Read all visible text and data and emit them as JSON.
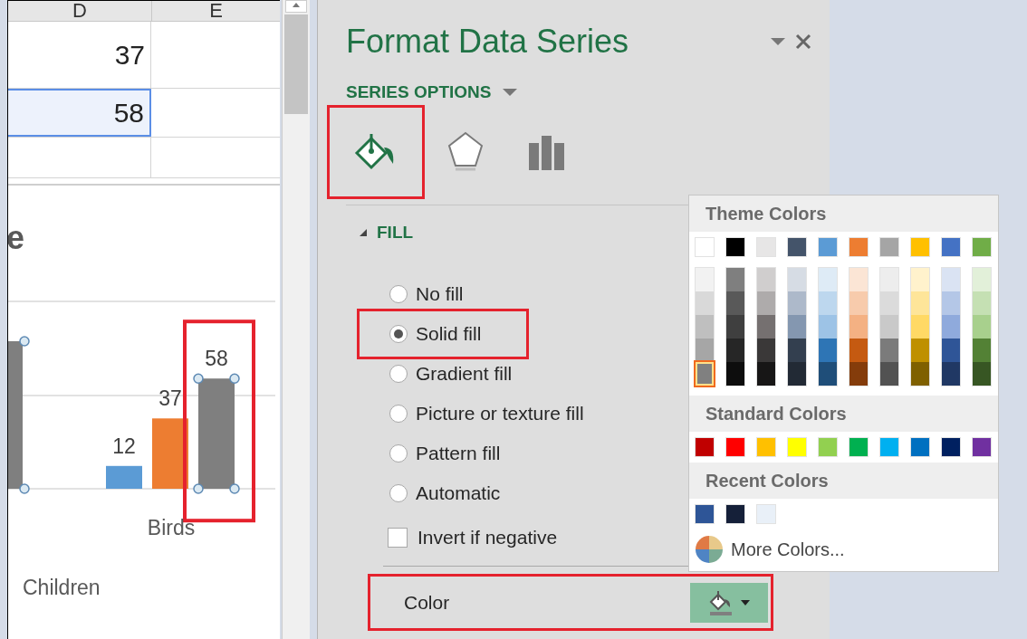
{
  "sheet": {
    "columns": [
      "D",
      "E"
    ],
    "rows": [
      {
        "value": "37",
        "selected": false
      },
      {
        "value": "58",
        "selected": true
      }
    ]
  },
  "chart": {
    "title_fragment": "e",
    "group_label": "Children",
    "chart_data": {
      "type": "bar",
      "categories": [
        "Birds"
      ],
      "data_labels": true,
      "series": [
        {
          "color": "#5b9bd5",
          "values": [
            12
          ]
        },
        {
          "color": "#ed7d31",
          "values": [
            37
          ]
        },
        {
          "color": "#7f7f7f",
          "values": [
            58
          ]
        }
      ]
    },
    "series_states": [
      {
        "selected": false,
        "highlighted": false
      },
      {
        "selected": false,
        "highlighted": false
      },
      {
        "selected": true,
        "highlighted": true
      }
    ]
  },
  "pane": {
    "title": "Format Data Series",
    "menu": "SERIES OPTIONS",
    "tabs": [
      {
        "kind": "fill",
        "selected": true,
        "highlighted": true
      },
      {
        "kind": "effects",
        "selected": false,
        "highlighted": false
      },
      {
        "kind": "series",
        "selected": false,
        "highlighted": false
      }
    ],
    "fill": {
      "heading": "FILL",
      "expanded": true,
      "options": [
        {
          "label": "No fill",
          "selected": false,
          "highlighted": false
        },
        {
          "label": "Solid fill",
          "selected": true,
          "highlighted": true
        },
        {
          "label": "Gradient fill",
          "selected": false,
          "highlighted": false
        },
        {
          "label": "Picture or texture fill",
          "selected": false,
          "highlighted": false
        },
        {
          "label": "Pattern fill",
          "selected": false,
          "highlighted": false
        },
        {
          "label": "Automatic",
          "selected": false,
          "highlighted": false
        }
      ],
      "invert": {
        "label": "Invert if negative",
        "checked": false
      },
      "color": {
        "label": "Color",
        "highlighted": true
      }
    }
  },
  "color_menu": {
    "theme_heading": "Theme Colors",
    "theme": [
      {
        "color": "#ffffff",
        "selected": false,
        "shades": [
          {
            "color": "#f2f2f2",
            "selected": false
          },
          {
            "color": "#d9d9d9",
            "selected": false
          },
          {
            "color": "#bfbfbf",
            "selected": false
          },
          {
            "color": "#a6a6a6",
            "selected": false
          },
          {
            "color": "#808080",
            "selected": true
          }
        ]
      },
      {
        "color": "#000000",
        "selected": false,
        "shades": [
          {
            "color": "#7f7f7f",
            "selected": false
          },
          {
            "color": "#595959",
            "selected": false
          },
          {
            "color": "#3f3f3f",
            "selected": false
          },
          {
            "color": "#262626",
            "selected": false
          },
          {
            "color": "#0d0d0d",
            "selected": false
          }
        ]
      },
      {
        "color": "#e7e6e6",
        "selected": false,
        "shades": [
          {
            "color": "#d0cece",
            "selected": false
          },
          {
            "color": "#aeabab",
            "selected": false
          },
          {
            "color": "#757070",
            "selected": false
          },
          {
            "color": "#3a3838",
            "selected": false
          },
          {
            "color": "#171616",
            "selected": false
          }
        ]
      },
      {
        "color": "#44546a",
        "selected": false,
        "shades": [
          {
            "color": "#d6dce4",
            "selected": false
          },
          {
            "color": "#adb9ca",
            "selected": false
          },
          {
            "color": "#8497b0",
            "selected": false
          },
          {
            "color": "#333f4f",
            "selected": false
          },
          {
            "color": "#222a35",
            "selected": false
          }
        ]
      },
      {
        "color": "#5b9bd5",
        "selected": false,
        "shades": [
          {
            "color": "#deebf6",
            "selected": false
          },
          {
            "color": "#bdd7ee",
            "selected": false
          },
          {
            "color": "#9dc3e6",
            "selected": false
          },
          {
            "color": "#2e75b5",
            "selected": false
          },
          {
            "color": "#1f4e79",
            "selected": false
          }
        ]
      },
      {
        "color": "#ed7d31",
        "selected": false,
        "shades": [
          {
            "color": "#fbe5d5",
            "selected": false
          },
          {
            "color": "#f7cbac",
            "selected": false
          },
          {
            "color": "#f4b183",
            "selected": false
          },
          {
            "color": "#c55a11",
            "selected": false
          },
          {
            "color": "#843c0b",
            "selected": false
          }
        ]
      },
      {
        "color": "#a5a5a5",
        "selected": false,
        "shades": [
          {
            "color": "#ededed",
            "selected": false
          },
          {
            "color": "#dbdbdb",
            "selected": false
          },
          {
            "color": "#c9c9c9",
            "selected": false
          },
          {
            "color": "#7b7b7b",
            "selected": false
          },
          {
            "color": "#525252",
            "selected": false
          }
        ]
      },
      {
        "color": "#ffc000",
        "selected": false,
        "shades": [
          {
            "color": "#fff2cc",
            "selected": false
          },
          {
            "color": "#fee599",
            "selected": false
          },
          {
            "color": "#ffd965",
            "selected": false
          },
          {
            "color": "#bf9000",
            "selected": false
          },
          {
            "color": "#7f6000",
            "selected": false
          }
        ]
      },
      {
        "color": "#4472c4",
        "selected": false,
        "shades": [
          {
            "color": "#dae3f3",
            "selected": false
          },
          {
            "color": "#b4c7e7",
            "selected": false
          },
          {
            "color": "#8faadc",
            "selected": false
          },
          {
            "color": "#2f5597",
            "selected": false
          },
          {
            "color": "#203864",
            "selected": false
          }
        ]
      },
      {
        "color": "#70ad47",
        "selected": false,
        "shades": [
          {
            "color": "#e2f0d9",
            "selected": false
          },
          {
            "color": "#c5e0b3",
            "selected": false
          },
          {
            "color": "#a8d08d",
            "selected": false
          },
          {
            "color": "#538135",
            "selected": false
          },
          {
            "color": "#375623",
            "selected": false
          }
        ]
      }
    ],
    "standard_heading": "Standard Colors",
    "standard": [
      {
        "color": "#c00000",
        "selected": false
      },
      {
        "color": "#ff0000",
        "selected": false
      },
      {
        "color": "#ffc000",
        "selected": false
      },
      {
        "color": "#ffff00",
        "selected": false
      },
      {
        "color": "#92d050",
        "selected": false
      },
      {
        "color": "#00b050",
        "selected": false
      },
      {
        "color": "#00b0f0",
        "selected": false
      },
      {
        "color": "#0070c0",
        "selected": false
      },
      {
        "color": "#002060",
        "selected": false
      },
      {
        "color": "#7030a0",
        "selected": false
      }
    ],
    "recent_heading": "Recent Colors",
    "recent": [
      {
        "color": "#2e5597",
        "selected": false
      },
      {
        "color": "#152039",
        "selected": false
      },
      {
        "color": "#e9f0f8",
        "selected": false
      }
    ],
    "more": "More Colors..."
  }
}
